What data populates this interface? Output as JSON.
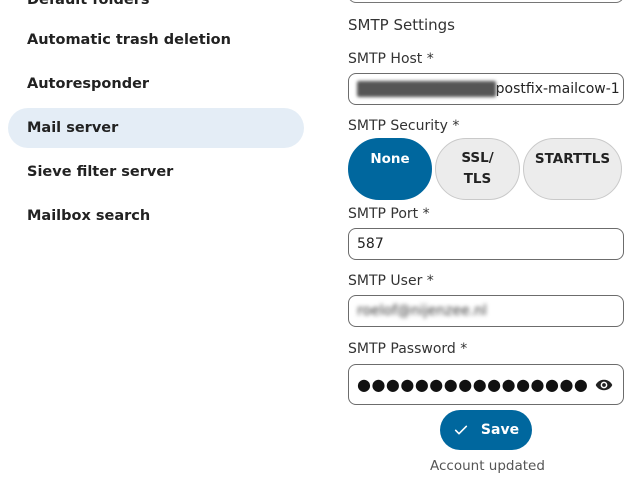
{
  "sidebar": {
    "items": [
      {
        "label": "Default folders"
      },
      {
        "label": "Automatic trash deletion"
      },
      {
        "label": "Autoresponder"
      },
      {
        "label": "Mail server",
        "active": true
      },
      {
        "label": "Sieve filter server"
      },
      {
        "label": "Mailbox search"
      }
    ]
  },
  "smtp": {
    "section_title": "SMTP Settings",
    "host_label": "SMTP Host *",
    "host_value_redacted": "mailcowdockerized-",
    "host_value_visible": "postfix-mailcow-1",
    "security_label": "SMTP Security *",
    "security_options": [
      {
        "label": "None",
        "selected": true
      },
      {
        "label": "SSL/ TLS",
        "selected": false
      },
      {
        "label": "STARTTLS",
        "selected": false
      }
    ],
    "port_label": "SMTP Port *",
    "port_value": "587",
    "user_label": "SMTP User *",
    "user_value": "roelof@nijenzee.nl",
    "password_label": "SMTP Password *",
    "password_value": "●●●●●●●●●●●●●●●●●●●●●",
    "save_label": "Save",
    "status_text": "Account updated"
  },
  "colors": {
    "accent": "#00679e",
    "active_nav_bg": "#e4edf6"
  },
  "icons": [
    "eye-icon",
    "check-icon"
  ]
}
